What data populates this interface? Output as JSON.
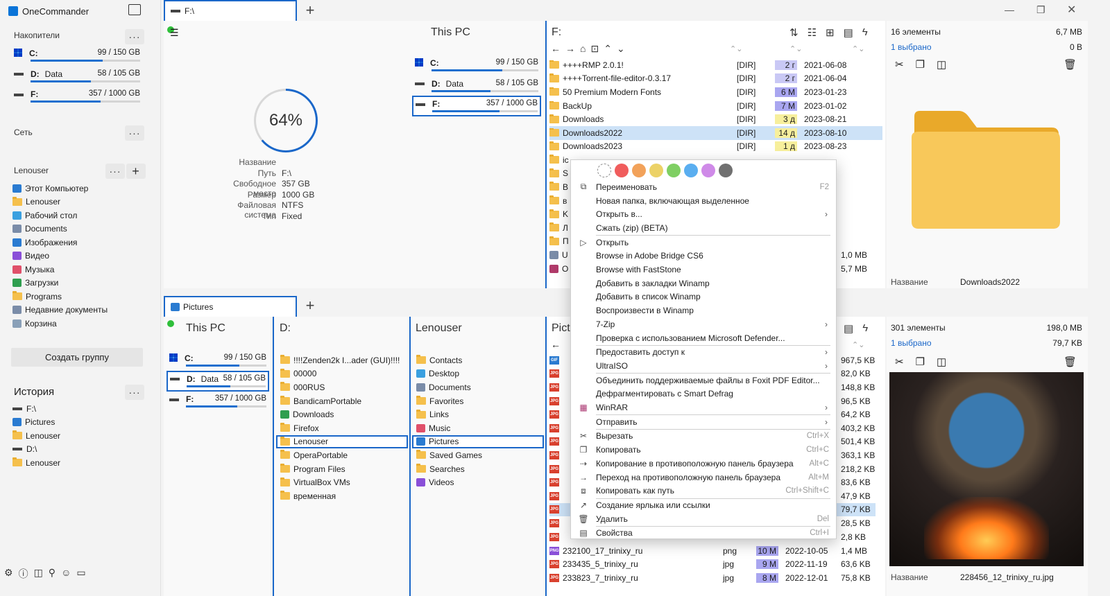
{
  "app": {
    "title": "OneCommander"
  },
  "sidebar": {
    "drives_header": "Накопители",
    "drives": [
      {
        "letter": "C:",
        "name": "",
        "size": "99 / 150 GB",
        "fill": 0.66
      },
      {
        "letter": "D:",
        "name": "Data",
        "size": "58 / 105 GB",
        "fill": 0.55
      },
      {
        "letter": "F:",
        "name": "",
        "size": "357 / 1000 GB",
        "fill": 0.64
      }
    ],
    "network_header": "Сеть",
    "user_header": "Lenouser",
    "favorites": [
      {
        "label": "Этот Компьютер",
        "icon": "pc-icon"
      },
      {
        "label": "Lenouser",
        "icon": "folder-icon"
      },
      {
        "label": "Рабочий стол",
        "icon": "desktop-icon"
      },
      {
        "label": "Documents",
        "icon": "documents-icon"
      },
      {
        "label": "Изображения",
        "icon": "pictures-icon"
      },
      {
        "label": "Видео",
        "icon": "video-icon"
      },
      {
        "label": "Музыка",
        "icon": "music-icon"
      },
      {
        "label": "Загрузки",
        "icon": "download-icon"
      },
      {
        "label": "Programs",
        "icon": "folder-icon"
      },
      {
        "label": "Недавние документы",
        "icon": "recent-icon"
      },
      {
        "label": "Корзина",
        "icon": "recycle-bin-icon"
      }
    ],
    "create_group": "Создать группу",
    "history_header": "История",
    "history": [
      {
        "label": "F:\\",
        "icon": "drive-icon"
      },
      {
        "label": "Pictures",
        "icon": "pictures-icon"
      },
      {
        "label": "Lenouser",
        "icon": "folder-icon"
      },
      {
        "label": "D:\\",
        "icon": "drive-icon"
      },
      {
        "label": "Lenouser",
        "icon": "folder-icon"
      }
    ]
  },
  "top": {
    "tab": "F:\\",
    "thispc_title": "This PC",
    "gauge_value": 64,
    "gauge_text": "64%",
    "info": [
      {
        "k": "Название",
        "v": ""
      },
      {
        "k": "Путь",
        "v": "F:\\"
      },
      {
        "k": "Свободное место",
        "v": "357 GB"
      },
      {
        "k": "Размер",
        "v": "1000 GB"
      },
      {
        "k": "Файловая система",
        "v": "NTFS"
      },
      {
        "k": "Тип",
        "v": "Fixed"
      }
    ],
    "drives": [
      {
        "letter": "C:",
        "name": "",
        "size": "99 / 150 GB",
        "fill": 0.66
      },
      {
        "letter": "D:",
        "name": "Data",
        "size": "58 / 105 GB",
        "fill": 0.55
      },
      {
        "letter": "F:",
        "name": "",
        "size": "357 / 1000 GB",
        "fill": 0.64
      }
    ],
    "list_title": "F:",
    "files": [
      {
        "name": "++++RMP 2.0.1!",
        "type": "[DIR]",
        "age": "2 г",
        "date": "2021-06-08",
        "age_color": "#c9c8f5"
      },
      {
        "name": "++++Torrent-file-editor-0.3.17",
        "type": "[DIR]",
        "age": "2 г",
        "date": "2021-06-04",
        "age_color": "#c9c8f5"
      },
      {
        "name": "50 Premium Modern Fonts",
        "type": "[DIR]",
        "age": "6 M",
        "date": "2023-01-23",
        "age_color": "#a9a6f0"
      },
      {
        "name": "BackUp",
        "type": "[DIR]",
        "age": "7 M",
        "date": "2023-01-02",
        "age_color": "#a9a6f0"
      },
      {
        "name": "Downloads",
        "type": "[DIR]",
        "age": "3 д",
        "date": "2023-08-21",
        "age_color": "#f7ef9c"
      },
      {
        "name": "Downloads2022",
        "type": "[DIR]",
        "age": "14 д",
        "date": "2023-08-10",
        "age_color": "#f7ef9c"
      },
      {
        "name": "Downloads2023",
        "type": "[DIR]",
        "age": "1 д",
        "date": "2023-08-23",
        "age_color": "#f7ef9c"
      }
    ],
    "partial_names": [
      "ic",
      "S",
      "B",
      "в",
      "K",
      "Л",
      "П",
      "U",
      "O"
    ],
    "partial_sizes": [
      "1,0 MB",
      "5,7 MB"
    ],
    "info_count": "16 элементы",
    "info_size": "6,7 MB",
    "info_selected": "1 выбрано",
    "info_selected_size": "0 B",
    "preview_name_label": "Название",
    "preview_name_value": "Downloads2022"
  },
  "bottom": {
    "tab": "Pictures",
    "col1_title": "This PC",
    "col1_drives": [
      {
        "letter": "C:",
        "name": "",
        "size": "99 / 150 GB",
        "fill": 0.66
      },
      {
        "letter": "D:",
        "name": "Data",
        "size": "58 / 105 GB",
        "fill": 0.55
      },
      {
        "letter": "F:",
        "name": "",
        "size": "357 / 1000 GB",
        "fill": 0.64
      }
    ],
    "col2_title": "D:",
    "col2_items": [
      "!!!!Zenden2k I...ader (GUI)!!!!",
      "00000",
      "000RUS",
      "BandicamPortable",
      "Downloads",
      "Firefox",
      "Lenouser",
      "OperaPortable",
      "Program Files",
      "VirtualBox VMs",
      "временная"
    ],
    "col3_title": "Lenouser",
    "col3_items": [
      "Contacts",
      "Desktop",
      "Documents",
      "Favorites",
      "Links",
      "Music",
      "Pictures",
      "Saved Games",
      "Searches",
      "Videos"
    ],
    "col4_title": "Pict",
    "sizes": [
      "967,5 KB",
      "82,0 KB",
      "148,8 KB",
      "96,5 KB",
      "64,2 KB",
      "403,2 KB",
      "501,4 KB",
      "363,1 KB",
      "218,2 KB",
      "83,6 KB",
      "47,9 KB",
      "79,7 KB",
      "28,5 KB",
      "2,8 KB"
    ],
    "files": [
      {
        "name": "232100_17_trinixy_ru",
        "type": "png",
        "age": "10 M",
        "date": "2022-10-05",
        "size": "1,4 MB"
      },
      {
        "name": "233435_5_trinixy_ru",
        "type": "jpg",
        "age": "9 M",
        "date": "2022-11-19",
        "size": "63,6 KB"
      },
      {
        "name": "233823_7_trinixy_ru",
        "type": "jpg",
        "age": "8 M",
        "date": "2022-12-01",
        "size": "75,8 KB"
      }
    ],
    "info_count": "301 элементы",
    "info_size": "198,0 MB",
    "info_selected": "1 выбрано",
    "info_selected_size": "79,7 KB",
    "preview_name_label": "Название",
    "preview_name_value": "228456_12_trinixy_ru.jpg"
  },
  "context_menu": {
    "colors": [
      "#ffffff",
      "#f05d5d",
      "#f2a25a",
      "#ecd267",
      "#7fcf63",
      "#5aaef0",
      "#cf8ae8",
      "#707070"
    ],
    "items": [
      {
        "label": "Переименовать",
        "shortcut": "F2",
        "icon": "rename-icon",
        "arrow": false
      },
      {
        "label": "Новая папка, включающая выделенное",
        "shortcut": "",
        "icon": "",
        "arrow": false
      },
      {
        "label": "Открыть в...",
        "shortcut": "",
        "icon": "",
        "arrow": true
      },
      {
        "label": "Сжать (zip) (BETA)",
        "shortcut": "",
        "icon": "",
        "arrow": false,
        "sep_after": true
      },
      {
        "label": "Открыть",
        "shortcut": "",
        "icon": "play-icon",
        "arrow": false
      },
      {
        "label": "Browse in Adobe Bridge CS6",
        "shortcut": "",
        "icon": "",
        "arrow": false
      },
      {
        "label": "Browse with FastStone",
        "shortcut": "",
        "icon": "",
        "arrow": false
      },
      {
        "label": "Добавить в закладки Winamp",
        "shortcut": "",
        "icon": "",
        "arrow": false
      },
      {
        "label": "Добавить в список Winamp",
        "shortcut": "",
        "icon": "",
        "arrow": false
      },
      {
        "label": "Воспроизвести в Winamp",
        "shortcut": "",
        "icon": "",
        "arrow": false
      },
      {
        "label": "7-Zip",
        "shortcut": "",
        "icon": "",
        "arrow": true
      },
      {
        "label": "Проверка с использованием Microsoft Defender...",
        "shortcut": "",
        "icon": "",
        "arrow": false,
        "sep_after": true
      },
      {
        "label": "Предоставить доступ к",
        "shortcut": "",
        "icon": "",
        "arrow": true
      },
      {
        "label": "UltraISO",
        "shortcut": "",
        "icon": "",
        "arrow": true,
        "sep_after": true
      },
      {
        "label": "Объединить поддерживаемые файлы в Foxit PDF Editor...",
        "shortcut": "",
        "icon": "",
        "arrow": false
      },
      {
        "label": "Дефрагментировать с Smart Defrag",
        "shortcut": "",
        "icon": "",
        "arrow": false
      },
      {
        "label": "WinRAR",
        "shortcut": "",
        "icon": "winrar-icon",
        "arrow": true,
        "sep_after": true
      },
      {
        "label": "Отправить",
        "shortcut": "",
        "icon": "",
        "arrow": true,
        "sep_after": true
      },
      {
        "label": "Вырезать",
        "shortcut": "Ctrl+X",
        "icon": "cut-icon",
        "arrow": false
      },
      {
        "label": "Копировать",
        "shortcut": "Ctrl+C",
        "icon": "copy-icon",
        "arrow": false
      },
      {
        "label": "Копирование в противоположную панель браузера",
        "shortcut": "Alt+C",
        "icon": "copy-arrow-icon",
        "arrow": false
      },
      {
        "label": "Переход на противоположную панель браузера",
        "shortcut": "Alt+M",
        "icon": "move-arrow-icon",
        "arrow": false
      },
      {
        "label": "Копировать как путь",
        "shortcut": "Ctrl+Shift+C",
        "icon": "copy-path-icon",
        "arrow": false,
        "sep_after": true
      },
      {
        "label": "Создание ярлыка или ссылки",
        "shortcut": "",
        "icon": "shortcut-icon",
        "arrow": false
      },
      {
        "label": "Удалить",
        "shortcut": "Del",
        "icon": "trash-icon",
        "arrow": false,
        "sep_after": true
      },
      {
        "label": "Свойства",
        "shortcut": "Ctrl+I",
        "icon": "properties-icon",
        "arrow": false
      }
    ]
  }
}
